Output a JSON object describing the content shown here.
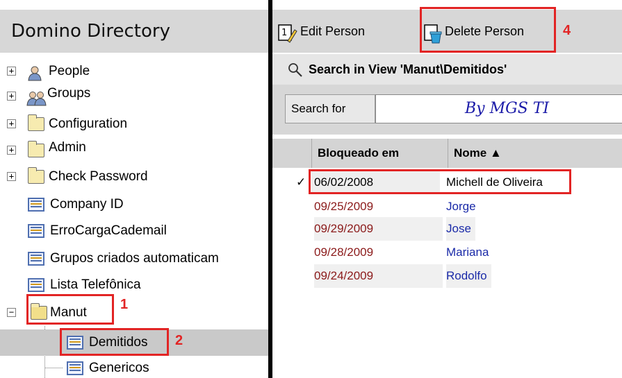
{
  "navigator": {
    "title": "Domino Directory",
    "items": [
      {
        "label": "People",
        "expand": "+"
      },
      {
        "label": "Groups",
        "expand": "+"
      },
      {
        "label": "Configuration",
        "expand": "+"
      },
      {
        "label": "Admin",
        "expand": "+"
      },
      {
        "label": "Check Password",
        "expand": "+"
      },
      {
        "label": "Company ID"
      },
      {
        "label": "ErroCargaCademail"
      },
      {
        "label": "Grupos criados automaticam"
      },
      {
        "label": "Lista Telefônica"
      },
      {
        "label": "Manut",
        "expand": "−"
      },
      {
        "label": "Demitidos"
      },
      {
        "label": "Genericos"
      }
    ]
  },
  "actions": {
    "edit_label": "Edit Person",
    "delete_label": "Delete Person"
  },
  "search": {
    "title": "Search in View 'Manut\\Demitidos'",
    "label": "Search for",
    "value": "By MGS TI"
  },
  "table": {
    "columns": [
      "Bloqueado em",
      "Nome ▲"
    ],
    "rows": [
      {
        "date": "06/02/2008",
        "name": "Michell de Oliveira",
        "mark": "✓"
      },
      {
        "date": "09/25/2009",
        "name": "Jorge"
      },
      {
        "date": "09/29/2009",
        "name": "Jose"
      },
      {
        "date": "09/28/2009",
        "name": "Mariana"
      },
      {
        "date": "09/24/2009",
        "name": "Rodolfo"
      }
    ]
  },
  "annotations": [
    "1",
    "2",
    "4"
  ],
  "colors": {
    "highlight": "#e22424",
    "date_text": "#8b1a1a",
    "name_text": "#1a2aa8",
    "pane_background": "#d7d7d7"
  },
  "icons": [
    "expand-icon",
    "person-icon",
    "group-icon",
    "folder-icon",
    "view-icon",
    "edit-person-icon",
    "delete-person-icon",
    "magnifier-icon",
    "checkmark-icon"
  ]
}
